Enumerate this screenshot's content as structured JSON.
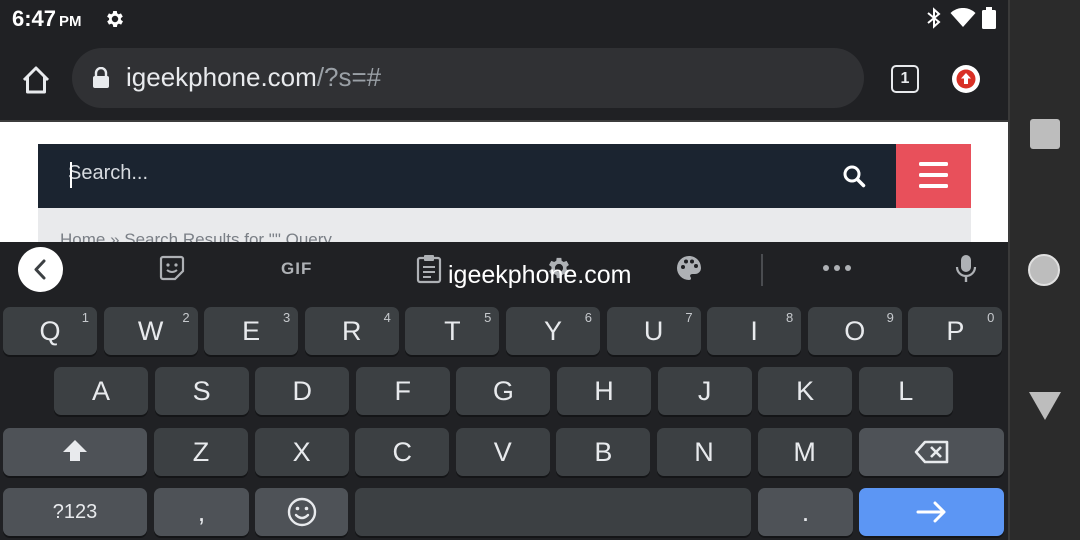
{
  "status_bar": {
    "time": "6:47",
    "ampm": "PM",
    "icons": [
      "settings-icon",
      "bluetooth-icon",
      "wifi-icon",
      "battery-icon"
    ]
  },
  "browser": {
    "url_host": "igeekphone.com",
    "url_path": "/?s=#",
    "tab_count": "1",
    "icons": [
      "home-icon",
      "lock-icon",
      "tab-switcher-icon",
      "update-available-icon"
    ]
  },
  "page": {
    "search_placeholder": "Search...",
    "breadcrumb": "Home  »  Search Results for \"\" Query",
    "colors": {
      "header": "#1b2430",
      "menu_button": "#e8505b"
    }
  },
  "keyboard": {
    "suggestion": "igeekphone.com",
    "gif_label": "GIF",
    "row1": [
      {
        "label": "Q",
        "hint": "1"
      },
      {
        "label": "W",
        "hint": "2"
      },
      {
        "label": "E",
        "hint": "3"
      },
      {
        "label": "R",
        "hint": "4"
      },
      {
        "label": "T",
        "hint": "5"
      },
      {
        "label": "Y",
        "hint": "6"
      },
      {
        "label": "U",
        "hint": "7"
      },
      {
        "label": "I",
        "hint": "8"
      },
      {
        "label": "O",
        "hint": "9"
      },
      {
        "label": "P",
        "hint": "0"
      }
    ],
    "row2": [
      "A",
      "S",
      "D",
      "F",
      "G",
      "H",
      "J",
      "K",
      "L"
    ],
    "row3": [
      "Z",
      "X",
      "C",
      "V",
      "B",
      "N",
      "M"
    ],
    "symbols_label": "?123",
    "comma_label": ",",
    "period_label": ".",
    "enter_color": "#5c96f4",
    "icons": [
      "back-chevron-icon",
      "sticker-icon",
      "clipboard-icon",
      "settings-icon",
      "palette-icon",
      "more-icon",
      "mic-icon",
      "shift-icon",
      "backspace-icon",
      "emoji-icon",
      "enter-arrow-icon"
    ]
  },
  "nav_bar": {
    "icons": [
      "recents-icon",
      "home-circle-icon",
      "back-triangle-icon"
    ]
  }
}
